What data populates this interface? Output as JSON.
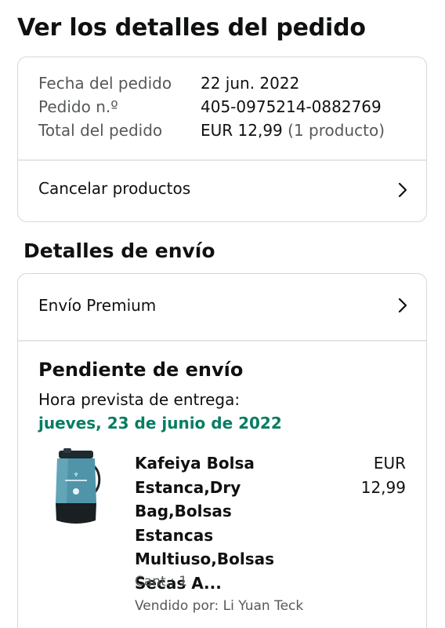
{
  "page": {
    "title": "Ver los detalles del pedido"
  },
  "order_summary": {
    "date_label": "Fecha del pedido",
    "date_value": "22 jun. 2022",
    "number_label": "Pedido n.º",
    "number_value": "405-0975214-0882769",
    "total_label": "Total del pedido",
    "total_value": "EUR 12,99",
    "total_items": "(1 producto)",
    "cancel_label": "Cancelar productos"
  },
  "shipping": {
    "section_title": "Detalles de envío",
    "method_label": "Envío Premium",
    "status": "Pendiente de envío",
    "delivery_label": "Hora prevista de entrega:",
    "delivery_date": "jueves, 23 de junio de 2022",
    "colors": {
      "delivery_date": "#067d62"
    }
  },
  "product": {
    "title": "Kafeiya Bolsa Estanca,Dry Bag,Bolsas Estancas Multiuso,Bolsas Secas A...",
    "price_currency": "EUR",
    "price_amount": "12,99",
    "quantity": "Cant.: 1",
    "seller": "Vendido por: Li Yuan Teck",
    "image_icon": "dry-bag-product-image"
  },
  "icons": {
    "chevron": "chevron-right-icon"
  }
}
